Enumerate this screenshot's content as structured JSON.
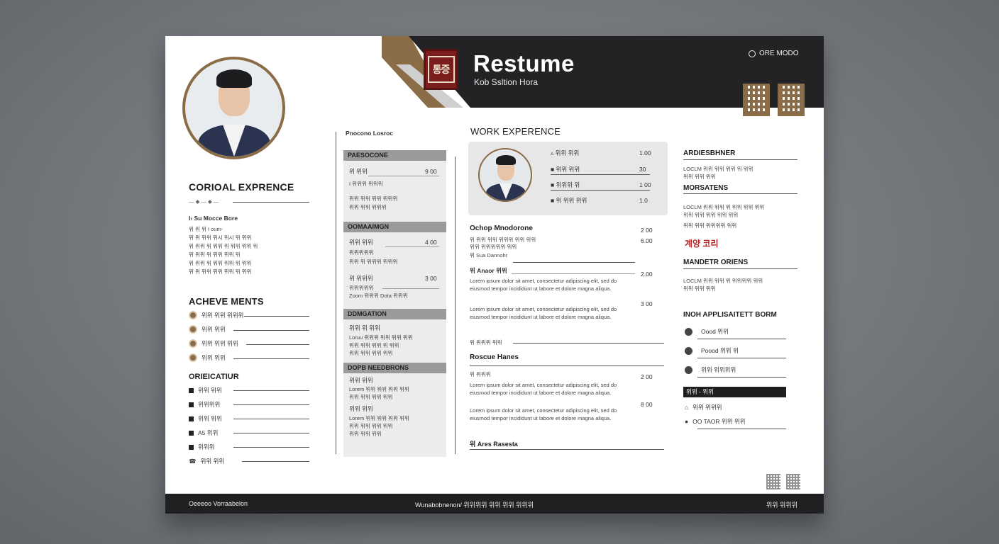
{
  "header": {
    "logo_text": "통증",
    "title": "Restume",
    "subtitle": "Kob Ssltion Hora",
    "lang_label": "ORE MODO"
  },
  "left": {
    "section1_title": "CORIOAL EXPRENCE",
    "section1_sub": "I‹ Su Mocce Bore",
    "section1_lines": [
      "위 위 위 I oum-",
      "위 위 위위 위시 위시 위 위위",
      "위 위위 위 위위 위 위위 위위 위",
      "위 위위 위 위위 위위 위",
      "위 위위 위 위위 위위 위 위위",
      "위 위 위위 위위 위위 위 위위"
    ],
    "achievements_title": "ACHEVE MENTS",
    "achievements": [
      "위위 위위 위위위",
      "위위 위위",
      "위위 위위 위위",
      "위위 위위"
    ],
    "education_title": "ORIEICATIUR",
    "education": [
      "위위 위위",
      "위위위위",
      "위위 위위",
      "A5 위위",
      "위위위",
      "위위 위위"
    ]
  },
  "middle": {
    "top_label": "Pnocono Losroc",
    "bars": [
      "PAESOCONE",
      "OOMAAIMGN",
      "DDMGATION",
      "DOPB NEEDBRONS"
    ],
    "b1": {
      "title": "위 위위",
      "value": "9 00",
      "l1": "I 위위위 위위위",
      "l2": "위위 위위 위위 위위위",
      "l3": "위위 위위 위위위"
    },
    "b2": {
      "title": "위위 위위",
      "value": "4 00",
      "l1": "위위위위위",
      "l2": "위위 위 위위위 위위위",
      "title2": "위 위위위",
      "value2": "3 00",
      "l3": "위위위위위",
      "l4": "Zoom 위위위 Dota 위위위"
    },
    "b3": {
      "title": "위위 위 위위",
      "l1": "Loruu 위위위 위위 위위 위위",
      "l2": "위위 위위 위위 위 위위",
      "l3": "위위 위위 위위 위위"
    },
    "b4": {
      "title": "위위 위위",
      "l1": "Lorem 위위 위위 위위 위위",
      "l2": "위위 위위 위위 위위",
      "title2": "위위 위위",
      "l3": "Lorem 위위 위위 위위 위위",
      "l4": "위위 위위 위위 위위",
      "l5": "위위 위위 위위"
    }
  },
  "work": {
    "title": "WORK EXPERENCE",
    "box_rows": [
      {
        "label": "위위 위위",
        "value": "1.00"
      },
      {
        "label": "위위 위위",
        "value": "30"
      },
      {
        "label": "위위위 위",
        "value": "1 00"
      },
      {
        "label": "위 위위 위위",
        "value": "1.0"
      }
    ],
    "job1_title": "Ochop Mnodorone",
    "job1_value": "2 00",
    "job1_l1": "위 위위 위위 위위위 위위 위위",
    "job1_value2": "6.00",
    "job1_l2": "위위 위위위위위 위위",
    "job1_l3": "위 Sua Dannohr",
    "job2_title": "위 Anaor 위위",
    "job2_value": "2.00",
    "job2_value3": "3 00",
    "para": "Lorem ipsum dolor sit amet, consectetur adipiscing elit, sed do eiusmod tempor incididunt ut labore et dolore magna aliqua.",
    "job2_l_end": "위 위위위 위위",
    "job3_title": "Roscue Hanes",
    "job3_sub": "위 위위위",
    "job3_value": "2 00",
    "job3_value2": "8 00",
    "job4_title": "위 Ares Rasesta"
  },
  "right": {
    "sec1_title": "ARDIESBHNER",
    "sec1_l1": "LOCLM 위위 위위 위위 위 위위",
    "sec1_l2": "위위 위위 위위",
    "sec2_title": "MORSATENS",
    "sec2_l1": "LOCLM 위위 위위 위 위위 위위 위위",
    "sec2_l2": "위위 위위 위위 위위 위위",
    "sec2_l3": "위위 위위 위위위위 위위",
    "red_text": "계양 코리",
    "sec3_title": "MANDETR ORIENS",
    "sec3_l1": "LOCLM 위위 위위 위 위위위위 위위",
    "sec3_l2": "위위 위위 위위",
    "sec4_title": "INOH APPLISAITETT BORM",
    "sec4_items": [
      "Oood 위위",
      "Poood 위위 위",
      "위위 위위위위"
    ],
    "bar_label": "위위 - 위위",
    "contact1": "위위 위위위",
    "contact2": "OO TAOR 위위 위위"
  },
  "footer": {
    "left": "Oeeeoo Vorraabelon",
    "center": "Wunabobnenon/ 위위위위 위위 위위 위위위",
    "right": "위위 위위위"
  }
}
